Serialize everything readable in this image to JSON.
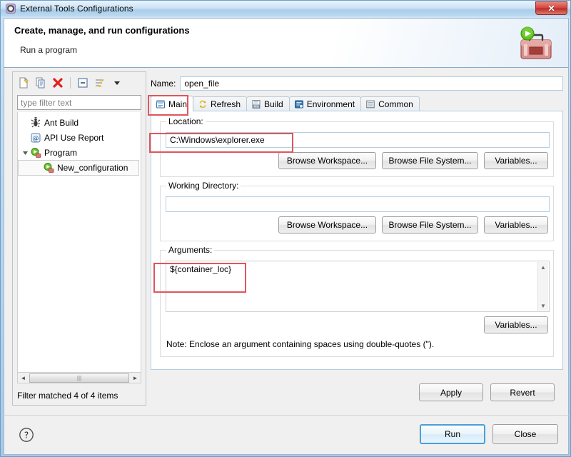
{
  "window": {
    "title": "External Tools Configurations",
    "title_ghost": "",
    "close_label": "✕",
    "icon": "external-tools-icon"
  },
  "header": {
    "title": "Create, manage, and run configurations",
    "subtitle": "Run a program",
    "icon": "toolbox-run-icon"
  },
  "toolbar": {
    "buttons": [
      {
        "name": "new-launch-configuration",
        "label": "New launch configuration"
      },
      {
        "name": "duplicate-launch-configuration",
        "label": "Duplicate"
      },
      {
        "name": "delete-launch-configuration",
        "label": "Delete"
      },
      {
        "name": "collapse-all",
        "label": "Collapse All"
      },
      {
        "name": "filter-launch-configurations",
        "label": "Filter"
      },
      {
        "name": "view-menu",
        "label": "View Menu"
      }
    ]
  },
  "filter": {
    "placeholder": "type filter text",
    "value": "",
    "status": "Filter matched 4 of 4 items"
  },
  "tree": {
    "items": [
      {
        "label": "Ant Build",
        "icon": "ant-build-icon",
        "indent": 1,
        "selected": false,
        "expandable": false
      },
      {
        "label": "API Use Report",
        "icon": "api-report-icon",
        "indent": 1,
        "selected": false,
        "expandable": false
      },
      {
        "label": "Program",
        "icon": "program-icon",
        "indent": 0,
        "selected": false,
        "expandable": true
      },
      {
        "label": "New_configuration",
        "icon": "program-icon",
        "indent": 2,
        "selected": true,
        "expandable": false
      }
    ]
  },
  "config": {
    "name_label": "Name:",
    "name_value": "open_file"
  },
  "tabs": [
    {
      "label": "Main",
      "icon": "main-tab-icon",
      "active": true
    },
    {
      "label": "Refresh",
      "icon": "refresh-tab-icon",
      "active": false
    },
    {
      "label": "Build",
      "icon": "build-tab-icon",
      "active": false
    },
    {
      "label": "Environment",
      "icon": "environment-tab-icon",
      "active": false
    },
    {
      "label": "Common",
      "icon": "common-tab-icon",
      "active": false
    }
  ],
  "main_tab": {
    "location": {
      "legend": "Location:",
      "value": "C:\\Windows\\explorer.exe",
      "browse_workspace": "Browse Workspace...",
      "browse_file_system": "Browse File System...",
      "variables": "Variables..."
    },
    "working_directory": {
      "legend": "Working Directory:",
      "value": "",
      "browse_workspace": "Browse Workspace...",
      "browse_file_system": "Browse File System...",
      "variables": "Variables..."
    },
    "arguments": {
      "legend": "Arguments:",
      "value": "${container_loc}",
      "variables": "Variables...",
      "note": "Note: Enclose an argument containing spaces using double-quotes (\")."
    }
  },
  "actions": {
    "apply": "Apply",
    "revert": "Revert",
    "run": "Run",
    "close": "Close",
    "help": "?"
  },
  "colors": {
    "annotation": "#e0555c",
    "accent": "#4a9fd8",
    "titlebar_top": "#eaf3fb",
    "close_red": "#d1453c"
  }
}
